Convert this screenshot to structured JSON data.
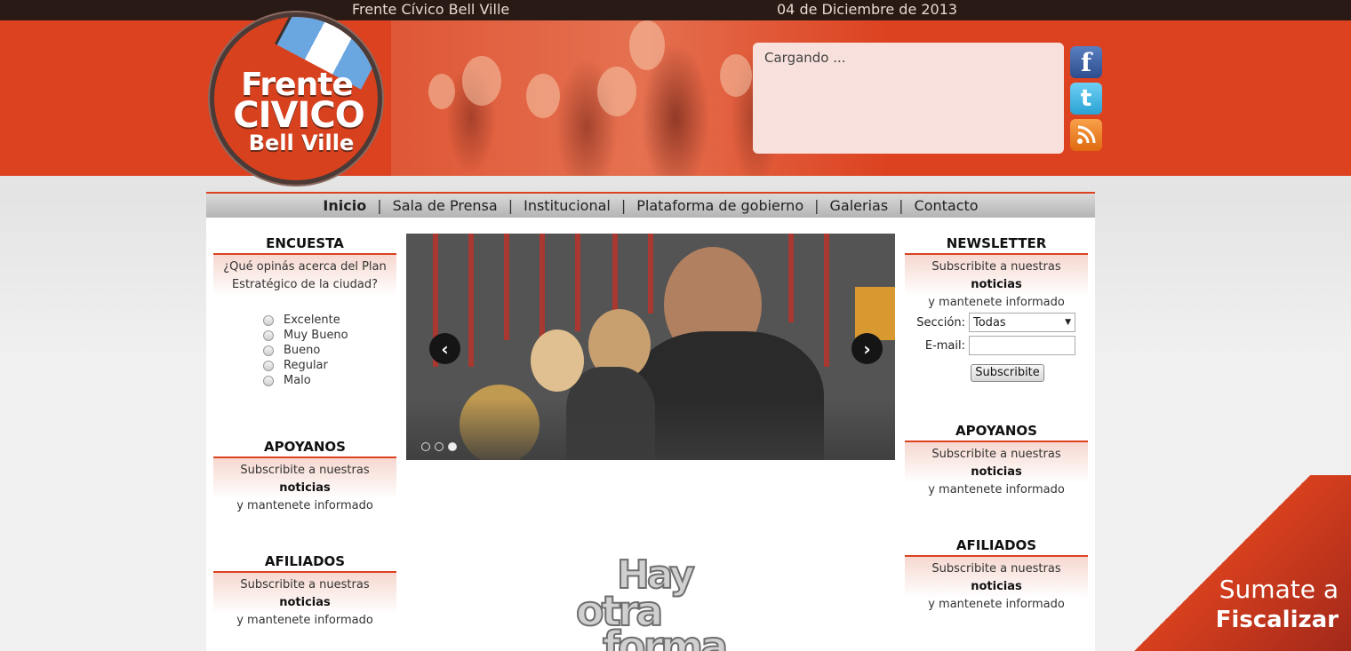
{
  "topbar": {
    "site_name": "Frente Cívico Bell Ville",
    "date": "04 de Diciembre de 2013"
  },
  "logo": {
    "line1": "Frente",
    "line2": "CIVICO",
    "line3": "Bell Ville"
  },
  "twitter_box": {
    "status": "Cargando ..."
  },
  "social": [
    {
      "name": "facebook-icon",
      "glyph": "f"
    },
    {
      "name": "twitter-icon",
      "glyph": "t"
    },
    {
      "name": "rss-icon",
      "glyph": ""
    }
  ],
  "nav": {
    "items": [
      {
        "label": "Inicio",
        "active": true
      },
      {
        "label": "Sala de Prensa"
      },
      {
        "label": "Institucional"
      },
      {
        "label": "Plataforma de gobierno"
      },
      {
        "label": "Galerias"
      },
      {
        "label": "Contacto"
      }
    ],
    "separator": "|"
  },
  "encuesta": {
    "title": "ENCUESTA",
    "question": "¿Qué opinás acerca del Plan Estratégico de la ciudad?",
    "options": [
      "Excelente",
      "Muy Bueno",
      "Bueno",
      "Regular",
      "Malo"
    ]
  },
  "apoyanos_left": {
    "title": "APOYANOS",
    "text_pre": "Subscribite a nuestras",
    "text_bold": "noticias",
    "text_post": "y mantenete informado"
  },
  "afiliados_left": {
    "title": "AFILIADOS",
    "text_pre": "Subscribite a nuestras",
    "text_bold": "noticias",
    "text_post": "y mantenete informado"
  },
  "slider": {
    "prev": "‹",
    "next": "›",
    "slides": 3,
    "active_slide": 3
  },
  "banner": {
    "line1": "Hay",
    "line2": "otra",
    "line3": "forma"
  },
  "newsletter": {
    "title": "NEWSLETTER",
    "text_pre": "Subscribite a nuestras",
    "text_bold": "noticias",
    "text_post": "y mantenete informado",
    "section_label": "Sección:",
    "section_value": "Todas",
    "email_label": "E-mail:",
    "email_value": "",
    "submit": "Subscribite"
  },
  "apoyanos_right": {
    "title": "APOYANOS",
    "text_pre": "Subscribite a nuestras",
    "text_bold": "noticias",
    "text_post": "y mantenete informado"
  },
  "afiliados_right": {
    "title": "AFILIADOS",
    "text_pre": "Subscribite a nuestras",
    "text_bold": "noticias",
    "text_post": "y mantenete informado"
  },
  "sumate": {
    "line1": "Sumate a",
    "line2": "Fiscalizar"
  },
  "colors": {
    "brand": "#dc4220",
    "topbar": "#2a1a16",
    "nav": "#c4c4c4"
  }
}
